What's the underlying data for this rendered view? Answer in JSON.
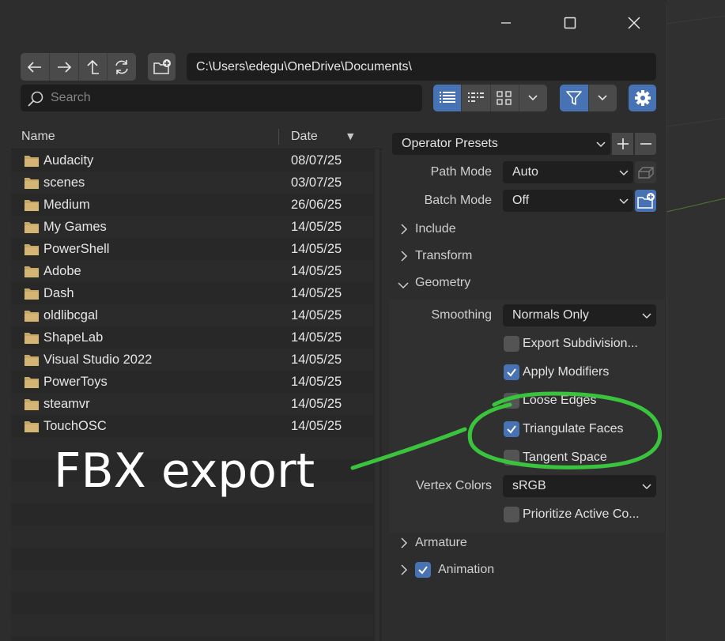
{
  "window": {
    "controls": {
      "minimize": "minimize",
      "maximize": "maximize",
      "close": "close"
    }
  },
  "toolbar": {
    "path": "C:\\Users\\edegu\\OneDrive\\Documents\\",
    "search_placeholder": "Search"
  },
  "file_list": {
    "headers": {
      "name": "Name",
      "date": "Date"
    },
    "items": [
      {
        "name": "Audacity",
        "date": "08/07/25"
      },
      {
        "name": "scenes",
        "date": "03/07/25"
      },
      {
        "name": "Medium",
        "date": "26/06/25"
      },
      {
        "name": "My Games",
        "date": "14/05/25"
      },
      {
        "name": "PowerShell",
        "date": "14/05/25"
      },
      {
        "name": "Adobe",
        "date": "14/05/25"
      },
      {
        "name": "Dash",
        "date": "14/05/25"
      },
      {
        "name": "oldlibcgal",
        "date": "14/05/25"
      },
      {
        "name": "ShapeLab",
        "date": "14/05/25"
      },
      {
        "name": "Visual Studio 2022",
        "date": "14/05/25"
      },
      {
        "name": "PowerToys",
        "date": "14/05/25"
      },
      {
        "name": "steamvr",
        "date": "14/05/25"
      },
      {
        "name": "TouchOSC",
        "date": "14/05/25"
      }
    ]
  },
  "panel": {
    "operator_presets": "Operator Presets",
    "path_mode": {
      "label": "Path Mode",
      "value": "Auto"
    },
    "batch_mode": {
      "label": "Batch Mode",
      "value": "Off"
    },
    "sections": {
      "include": "Include",
      "transform": "Transform",
      "geometry": "Geometry",
      "armature": "Armature",
      "animation": "Animation"
    },
    "geometry": {
      "smoothing": {
        "label": "Smoothing",
        "value": "Normals Only"
      },
      "export_subdivision": {
        "label": "Export Subdivision...",
        "checked": false
      },
      "apply_modifiers": {
        "label": "Apply Modifiers",
        "checked": true
      },
      "loose_edges": {
        "label": "Loose Edges",
        "checked": false
      },
      "triangulate_faces": {
        "label": "Triangulate Faces",
        "checked": true
      },
      "tangent_space": {
        "label": "Tangent Space",
        "checked": false
      },
      "vertex_colors": {
        "label": "Vertex Colors",
        "value": "sRGB"
      },
      "prioritize_active": {
        "label": "Prioritize Active Co...",
        "checked": false
      }
    },
    "animation_checked": true
  },
  "annotation": {
    "text": "FBX export",
    "color": "#3ac33c"
  },
  "colors": {
    "accent": "#4772b3",
    "folder": "#c7a867",
    "background": "#2d2d2d"
  }
}
